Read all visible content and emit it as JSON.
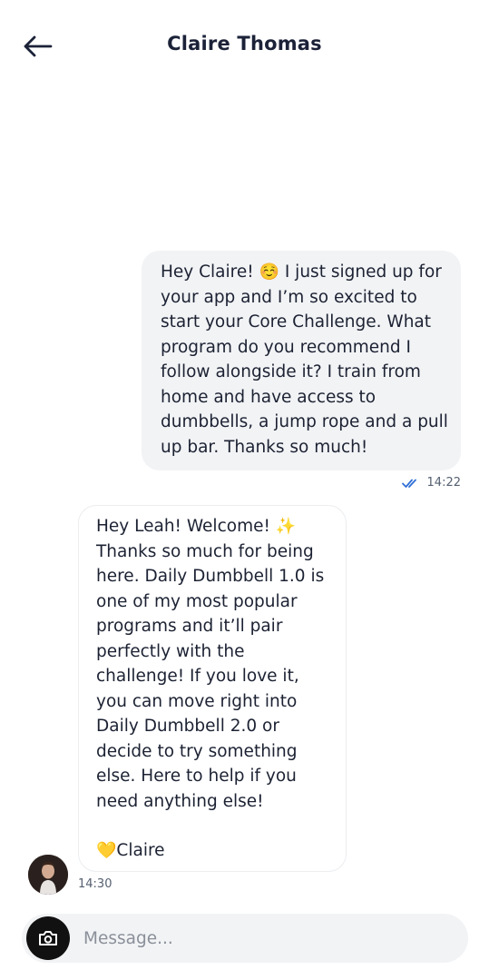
{
  "header": {
    "title": "Claire Thomas"
  },
  "messages": {
    "outgoing": {
      "text_a": "Hey Claire! ",
      "emoji": "☺️",
      "text_b": " I just signed up for your app and I’m so excited to start your Core Challenge. What program do you recommend I follow alongside it? I train from home and have access to dumbbells, a jump rope and a pull up bar. Thanks so much!",
      "time": "14:22",
      "status_icon": "double-check-icon"
    },
    "incoming": {
      "text_a": "Hey Leah! Welcome! ",
      "emoji": "✨",
      "text_b": "Thanks so much for being here. Daily Dumbbell  1.0 is one of my most popular programs and it’ll pair perfectly with the challenge! If you love it, you can move right into Daily Dumbbell 2.0 or decide to try something else. Here to help if you need anything else!",
      "sig_emoji": "💛",
      "signature": "Claire",
      "time": "14:30"
    }
  },
  "composer": {
    "placeholder": "Message...",
    "camera_icon": "camera-icon"
  },
  "colors": {
    "outgoing_bubble": "#f2f3f5",
    "read_check": "#2f6fd6",
    "title": "#1b2238"
  }
}
